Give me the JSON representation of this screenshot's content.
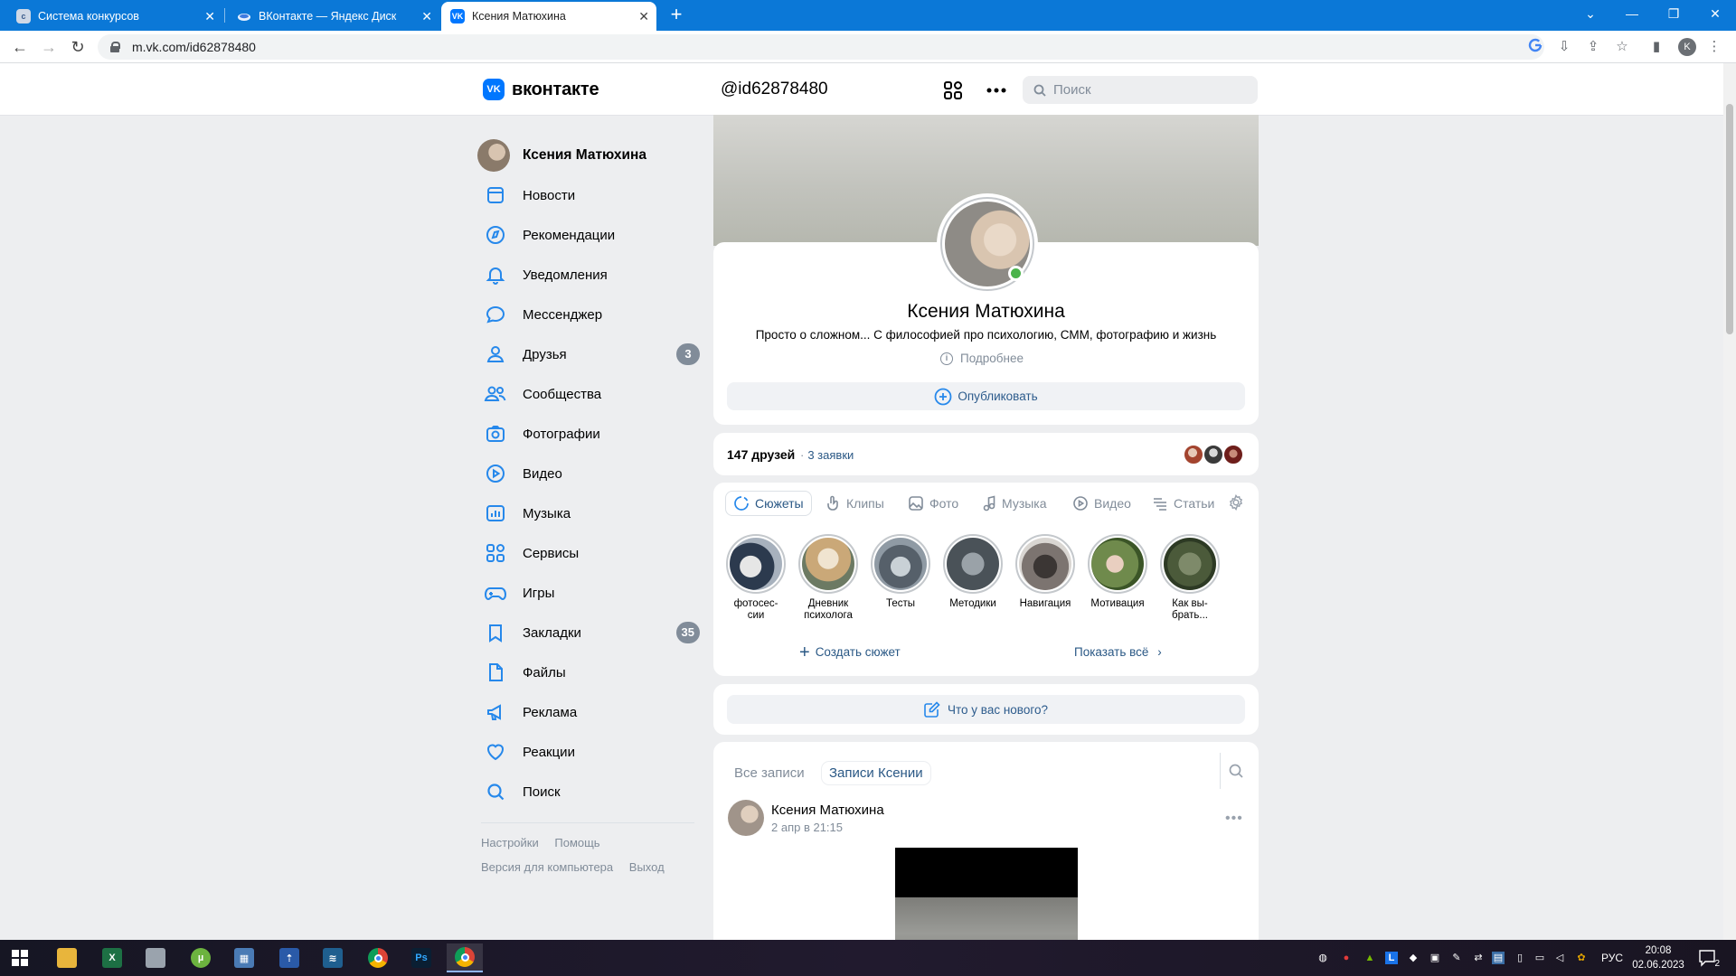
{
  "browser": {
    "tabs": [
      {
        "title": "Система конкурсов",
        "favicon": "ccs"
      },
      {
        "title": "ВКонтакте — Яндекс Диск",
        "favicon": "disk"
      },
      {
        "title": "Ксения Матюхина",
        "favicon": "vk"
      }
    ],
    "url": "m.vk.com/id62878480",
    "profile_letter": "K",
    "accent": "#0b78d7"
  },
  "vk": {
    "logo_text": "вконтакте",
    "handle": "@id62878480",
    "search_placeholder": "Поиск",
    "accent": "#0077ff"
  },
  "menu": {
    "profile_name": "Ксения Матюхина",
    "items": [
      {
        "label": "Новости",
        "icon": "news-icon"
      },
      {
        "label": "Рекомендации",
        "icon": "compass-icon"
      },
      {
        "label": "Уведомления",
        "icon": "bell-icon"
      },
      {
        "label": "Мессенджер",
        "icon": "chat-icon"
      },
      {
        "label": "Друзья",
        "icon": "user-icon",
        "badge": "3"
      },
      {
        "label": "Сообщества",
        "icon": "users-icon"
      },
      {
        "label": "Фотографии",
        "icon": "camera-icon"
      },
      {
        "label": "Видео",
        "icon": "play-icon"
      },
      {
        "label": "Музыка",
        "icon": "music-icon"
      },
      {
        "label": "Сервисы",
        "icon": "grid-icon"
      },
      {
        "label": "Игры",
        "icon": "gamepad-icon"
      },
      {
        "label": "Закладки",
        "icon": "bookmark-icon",
        "badge": "35"
      },
      {
        "label": "Файлы",
        "icon": "file-icon"
      },
      {
        "label": "Реклама",
        "icon": "megaphone-icon"
      },
      {
        "label": "Реакции",
        "icon": "heart-icon"
      },
      {
        "label": "Поиск",
        "icon": "search-icon"
      }
    ],
    "footer": {
      "settings": "Настройки",
      "help": "Помощь",
      "desktop_version": "Версия для компьютера",
      "logout": "Выход"
    }
  },
  "profile": {
    "name": "Ксения Матюхина",
    "status": "Просто о сложном... С философией про психологию, СММ, фотографию и жизнь",
    "more_info": "Подробнее",
    "publish": "Опубликовать",
    "online": true,
    "friends_count": "147 друзей",
    "friend_requests": "3 заявки"
  },
  "content_tabs": [
    "Сюжеты",
    "Клипы",
    "Фото",
    "Музыка",
    "Видео",
    "Статьи"
  ],
  "stories": [
    {
      "caption_line1": "фотосес-",
      "caption_line2": "сии"
    },
    {
      "caption_line1": "Дневник",
      "caption_line2": "психолога"
    },
    {
      "caption_line1": "Тесты",
      "caption_line2": ""
    },
    {
      "caption_line1": "Методики",
      "caption_line2": ""
    },
    {
      "caption_line1": "Навигация",
      "caption_line2": ""
    },
    {
      "caption_line1": "Мотивация",
      "caption_line2": ""
    },
    {
      "caption_line1": "Как вы-",
      "caption_line2": "брать..."
    }
  ],
  "stories_actions": {
    "create": "Создать сюжет",
    "show_all": "Показать всё"
  },
  "whats_new": "Что у вас нового?",
  "wall": {
    "tabs": [
      "Все записи",
      "Записи Ксении"
    ],
    "post": {
      "author": "Ксения Матюхина",
      "date": "2 апр в 21:15"
    }
  },
  "taskbar": {
    "lang": "РУС",
    "time": "20:08",
    "date": "02.06.2023",
    "notifications": "2"
  }
}
